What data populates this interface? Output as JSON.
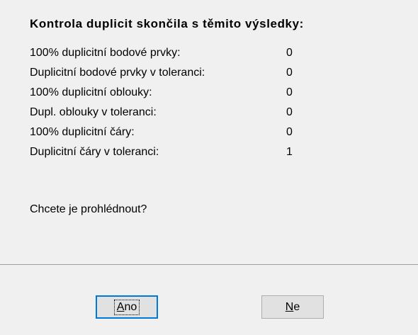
{
  "dialog": {
    "heading": "Kontrola duplicit skončila s těmito výsledky:",
    "results": [
      {
        "label": "100% duplicitní bodové prvky:",
        "value": "0"
      },
      {
        "label": "Duplicitní bodové prvky v toleranci:",
        "value": "0"
      },
      {
        "label": "100% duplicitní oblouky:",
        "value": "0"
      },
      {
        "label": "Dupl. oblouky v toleranci:",
        "value": "0"
      },
      {
        "label": "100% duplicitní čáry:",
        "value": "0"
      },
      {
        "label": "Duplicitní čáry v toleranci:",
        "value": "1"
      }
    ],
    "question": "Chcete je prohlédnout?"
  },
  "buttons": {
    "yes": {
      "mnemonic": "A",
      "rest": "no"
    },
    "no": {
      "mnemonic": "N",
      "rest": "e"
    }
  },
  "colors": {
    "background": "#f0f0f0",
    "focus_border": "#0078d7",
    "button_face": "#e1e1e1"
  }
}
